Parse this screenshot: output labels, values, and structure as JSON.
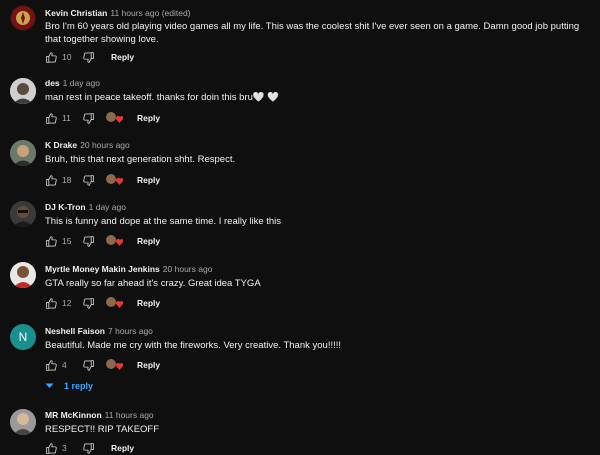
{
  "comments": [
    {
      "author": "Kevin Christian",
      "time": "11 hours ago (edited)",
      "text": "Bro I'm 60 years old playing video games all my life. This was the coolest shit I've ever seen on a game. Damn good job putting that together showing love.",
      "likes": "10",
      "reply_label": "Reply"
    },
    {
      "author": "des",
      "time": "1 day ago",
      "text": "man rest in peace takeoff. thanks for doin this bru🤍 🤍",
      "likes": "11",
      "reply_label": "Reply"
    },
    {
      "author": "K Drake",
      "time": "20 hours ago",
      "text": "Bruh, this that next generation shht.  Respect.",
      "likes": "18",
      "reply_label": "Reply"
    },
    {
      "author": "DJ K-Tron",
      "time": "1 day ago",
      "text": "This is funny and dope at the same time.  I really like this",
      "likes": "15",
      "reply_label": "Reply"
    },
    {
      "author": "Myrtle Money Makin Jenkins",
      "time": "20 hours ago",
      "text": "GTA really so far ahead it's crazy. Great idea TYGA",
      "likes": "12",
      "reply_label": "Reply"
    },
    {
      "author": "Neshell Faison",
      "time": "7 hours ago",
      "text": "Beautiful.   Made me cry with the fireworks.   Very creative.   Thank you!!!!!",
      "likes": "4",
      "reply_label": "Reply",
      "avatar_letter": "N",
      "avatar_color": "#1a8f8f",
      "replies_label": "1 reply"
    },
    {
      "author": "MR McKinnon",
      "time": "11 hours ago",
      "text": "RESPECT!! RIP TAKEOFF",
      "likes": "3",
      "reply_label": "Reply"
    }
  ],
  "colors": {
    "background": "#0f0f0f",
    "text": "#f1f1f1",
    "secondary": "#aaaaaa",
    "link": "#3ea6ff",
    "heart": "#e53935"
  }
}
